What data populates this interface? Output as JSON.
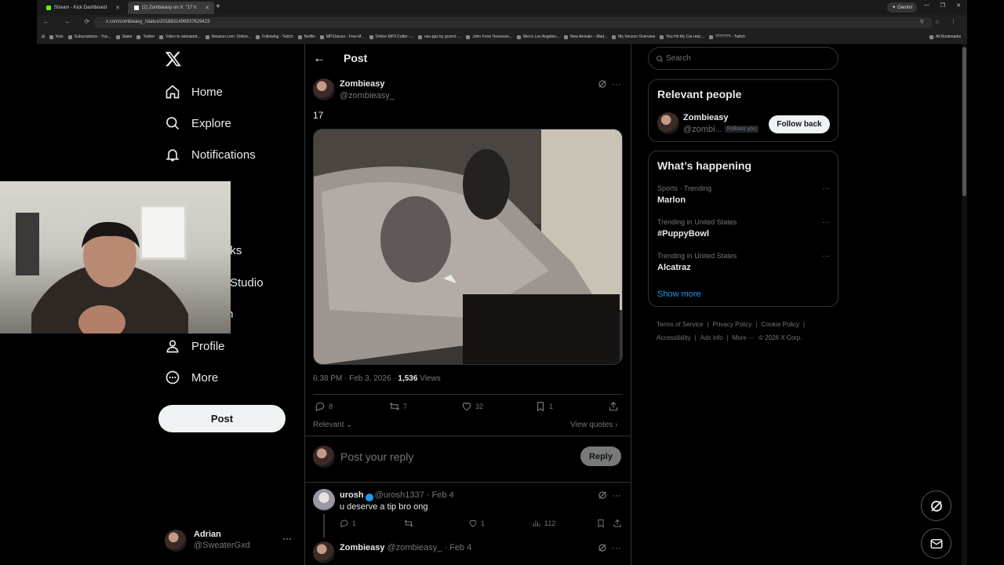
{
  "browser": {
    "tabs": [
      {
        "label": "Stream - Kick Dashboard",
        "color": "#53fc18"
      },
      {
        "label": "(2) Zombieasy on X: \"17 h",
        "color": "#ffffff"
      }
    ],
    "gemini_label": "Gemini",
    "url": "x.com/zombieasy_/status/2018831499937629423",
    "bookmarks": [
      "Kick",
      "Subscriptions - You...",
      "Stake",
      "Twitter",
      "Video to animated...",
      "Amazon.com: Online...",
      "Following - Twitch",
      "Netflix",
      "MP3Juices - Free M...",
      "Online MP3 Cutter -...",
      "osu-pps by grumd -...",
      "John From Tennesse...",
      "Men's Los Angeles...",
      "New Arrivals – Mad...",
      "My Verizon Overview",
      "You Hit My Car reac...",
      "??????? - Twitch"
    ],
    "all_bookmarks": "All Bookmarks"
  },
  "nav": {
    "items": [
      {
        "label": "Home",
        "icon": "home-icon"
      },
      {
        "label": "Explore",
        "icon": "search-icon"
      },
      {
        "label": "Notifications",
        "icon": "bell-icon"
      },
      {
        "label": "arks",
        "icon": "bookmark-icon"
      },
      {
        "label": "Studio",
        "icon": "studio-icon"
      },
      {
        "label": "m",
        "icon": "premium-icon"
      },
      {
        "label": "Profile",
        "icon": "person-icon"
      },
      {
        "label": "More",
        "icon": "more-circle-icon"
      }
    ],
    "post_button": "Post",
    "account": {
      "name": "Adrian",
      "handle": "@SweaterGxd"
    }
  },
  "post": {
    "header": "Post",
    "author_name": "Zombieasy",
    "author_handle": "@zombieasy_",
    "text": "17",
    "time": "6:38 PM · Feb 3, 2026 · ",
    "views_count": "1,536",
    "views_label": " Views",
    "stats": {
      "replies": "8",
      "reposts": "7",
      "likes": "32",
      "bookmarks": "1"
    },
    "sort_label": "Relevant",
    "view_quotes": "View quotes",
    "reply_placeholder": "Post your reply",
    "reply_button": "Reply"
  },
  "comments": [
    {
      "name": "urosh",
      "handle": "@urosh1337",
      "date": "· Feb 4",
      "text": "u deserve a tip bro ong",
      "replies": "1",
      "likes": "1",
      "views": "112"
    },
    {
      "name": "Zombieasy",
      "handle": "@zombieasy_",
      "date": "· Feb 4"
    }
  ],
  "sidebar": {
    "search_placeholder": "Search",
    "relevant_title": "Relevant people",
    "relevant_person": {
      "name": "Zombieasy",
      "handle": "@zombi...",
      "follows_you": "Follows you",
      "button": "Follow back"
    },
    "happening_title": "What’s happening",
    "trends": [
      {
        "category": "Sports · Trending",
        "title": "Marlon"
      },
      {
        "category": "Trending in United States",
        "title": "#PuppyBowl"
      },
      {
        "category": "Trending in United States",
        "title": "Alcatraz"
      }
    ],
    "show_more": "Show more",
    "footer": [
      "Terms of Service",
      "|",
      "Privacy Policy",
      "|",
      "Cookie Policy",
      "|",
      "Accessibility",
      "|",
      "Ads info",
      "|",
      "More ···",
      "© 2026 X Corp."
    ]
  },
  "colors": {
    "accent": "#1d9bf0",
    "bg": "#000000",
    "muted": "#71767b"
  }
}
